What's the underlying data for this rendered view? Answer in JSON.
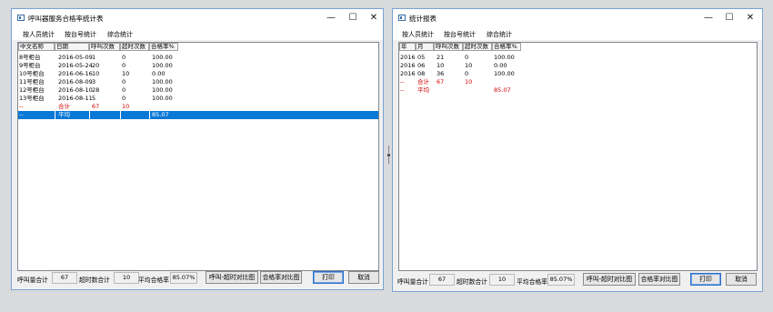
{
  "left": {
    "title": "呼叫器服务合格率统计表",
    "menu": [
      "按人员统计",
      "按台号统计",
      "综合统计"
    ],
    "headers": [
      "中文名称",
      "日期",
      "呼叫次数",
      "超时次数",
      "合格率%"
    ],
    "rows": [
      [
        "8号柜台",
        "2016-05-09",
        "1",
        "0",
        "100.00"
      ],
      [
        "9号柜台",
        "2016-05-24",
        "20",
        "0",
        "100.00"
      ],
      [
        "10号柜台",
        "2016-06-16",
        "10",
        "10",
        "0.00"
      ],
      [
        "11号柜台",
        "2016-08-09",
        "3",
        "0",
        "100.00"
      ],
      [
        "12号柜台",
        "2016-08-10",
        "28",
        "0",
        "100.00"
      ],
      [
        "13号柜台",
        "2016-08-11",
        "5",
        "0",
        "100.00"
      ]
    ],
    "total_row": [
      "--",
      "合计",
      "67",
      "10",
      ""
    ],
    "avg_row": [
      "--",
      "平均",
      "",
      "",
      "85.07"
    ],
    "footer": {
      "call_total_label": "呼叫量合计",
      "call_total": "67",
      "timeout_total_label": "超时数合计",
      "timeout_total": "10",
      "avg_rate_label": "平均合格率",
      "avg_rate": "85.07%",
      "btn_timeout_chart": "呼叫-超时对比图",
      "btn_rate_chart": "合格率对比图",
      "btn_print": "打印",
      "btn_cancel": "取消"
    }
  },
  "right": {
    "title": "统计报表",
    "menu": [
      "按人员统计",
      "按台号统计",
      "综合统计"
    ],
    "headers": [
      "年",
      "月",
      "呼叫次数",
      "超时次数",
      "合格率%"
    ],
    "rows": [
      [
        "2016",
        "05",
        "21",
        "0",
        "100.00"
      ],
      [
        "2016",
        "06",
        "10",
        "10",
        "0.00"
      ],
      [
        "2016",
        "08",
        "36",
        "0",
        "100.00"
      ]
    ],
    "total_row": [
      "--",
      "合计",
      "67",
      "10",
      ""
    ],
    "avg_row": [
      "--",
      "平均",
      "",
      "",
      "85.07"
    ],
    "footer": {
      "call_total_label": "呼叫量合计",
      "call_total": "67",
      "timeout_total_label": "超时数合计",
      "timeout_total": "10",
      "avg_rate_label": "平均合格率",
      "avg_rate": "85.07%",
      "btn_timeout_chart": "呼叫-超时对比图",
      "btn_rate_chart": "合格率对比图",
      "btn_print": "打印",
      "btn_cancel": "取消"
    }
  },
  "window_controls": {
    "minimize": "—",
    "maximize": "☐",
    "close": "✕"
  },
  "colors": {
    "selection": "#0a78d7",
    "summary_text": "#d40000",
    "window_border": "#7aa3d4"
  }
}
